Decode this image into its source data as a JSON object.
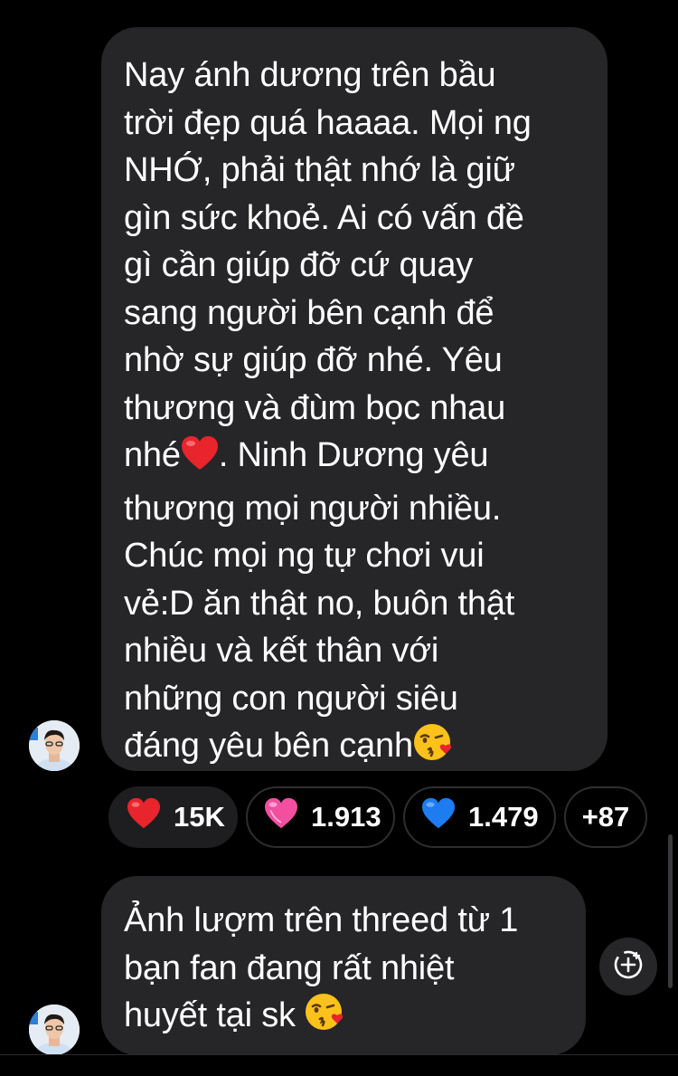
{
  "messages": [
    {
      "text_before_heart": "Nay ánh dương trên bầu\ntrời đẹp quá haaaa. Mọi ng\nNHỚ, phải thật nhớ là giữ\ngìn sức khoẻ. Ai có vấn đề\ngì cần giúp đỡ cứ quay\nsang người bên cạnh để\nnhờ sự giúp đỡ nhé. Yêu\nthương và đùm bọc nhau\nnhé",
      "text_after_heart": ". Ninh Dương yêu\nthương mọi người nhiều.\nChúc mọi ng tự chơi vui\nvẻ:D ăn thật no, buôn thật\nnhiều và kết thân với\nnhững con người siêu\nđáng yêu bên cạnh",
      "inline_emoji_1": "red-heart",
      "end_emoji": "kissing-face"
    },
    {
      "text": "Ảnh lượm trên threed từ 1\nbạn fan đang rất nhiệt\nhuyết tại sk ",
      "end_emoji": "kissing-face"
    }
  ],
  "reactions": [
    {
      "emoji": "red-heart",
      "count": "15K",
      "color": "#e8242c"
    },
    {
      "emoji": "pink-heart",
      "count": "1.913",
      "color": "#f24fa0"
    },
    {
      "emoji": "blue-heart",
      "count": "1.479",
      "color": "#1d7cf0"
    },
    {
      "emoji": "",
      "count": "+87",
      "color": ""
    }
  ],
  "actions": {
    "add_reaction_icon": "add-reaction-icon"
  },
  "colors": {
    "background": "#000000",
    "bubble": "#262628",
    "text": "#ffffff"
  }
}
